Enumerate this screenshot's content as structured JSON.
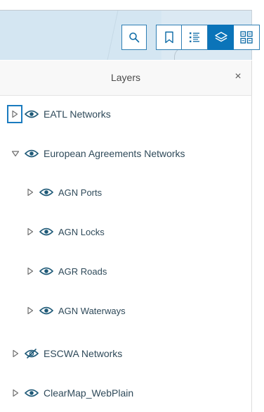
{
  "toolbar": {
    "buttons": [
      {
        "id": "search",
        "icon": "search-icon"
      },
      {
        "id": "bookmarks",
        "icon": "bookmark-icon"
      },
      {
        "id": "legend",
        "icon": "legend-list-icon"
      },
      {
        "id": "layers",
        "icon": "layers-icon",
        "active": true
      },
      {
        "id": "basemap",
        "icon": "basemap-gallery-icon"
      }
    ],
    "accent_color": "#0b74b9"
  },
  "panel": {
    "title": "Layers",
    "close_label": "×"
  },
  "layers": [
    {
      "title": "EATL Networks",
      "expanded": false,
      "visible": true,
      "level": 0,
      "focused": true
    },
    {
      "title": "European Agreements Networks",
      "expanded": true,
      "visible": true,
      "level": 0
    },
    {
      "title": "AGN Ports",
      "expanded": false,
      "visible": true,
      "level": 1
    },
    {
      "title": "AGN Locks",
      "expanded": false,
      "visible": true,
      "level": 1
    },
    {
      "title": "AGR Roads",
      "expanded": false,
      "visible": true,
      "level": 1
    },
    {
      "title": "AGN Waterways",
      "expanded": false,
      "visible": true,
      "level": 1
    },
    {
      "title": "ESCWA Networks",
      "expanded": false,
      "visible": false,
      "level": 0
    },
    {
      "title": "ClearMap_WebPlain",
      "expanded": false,
      "visible": true,
      "level": 0
    }
  ],
  "colors": {
    "layer_text": "#2f4a5a",
    "eye_icon": "#1f5a78",
    "focus_ring": "#1a7bbf"
  }
}
